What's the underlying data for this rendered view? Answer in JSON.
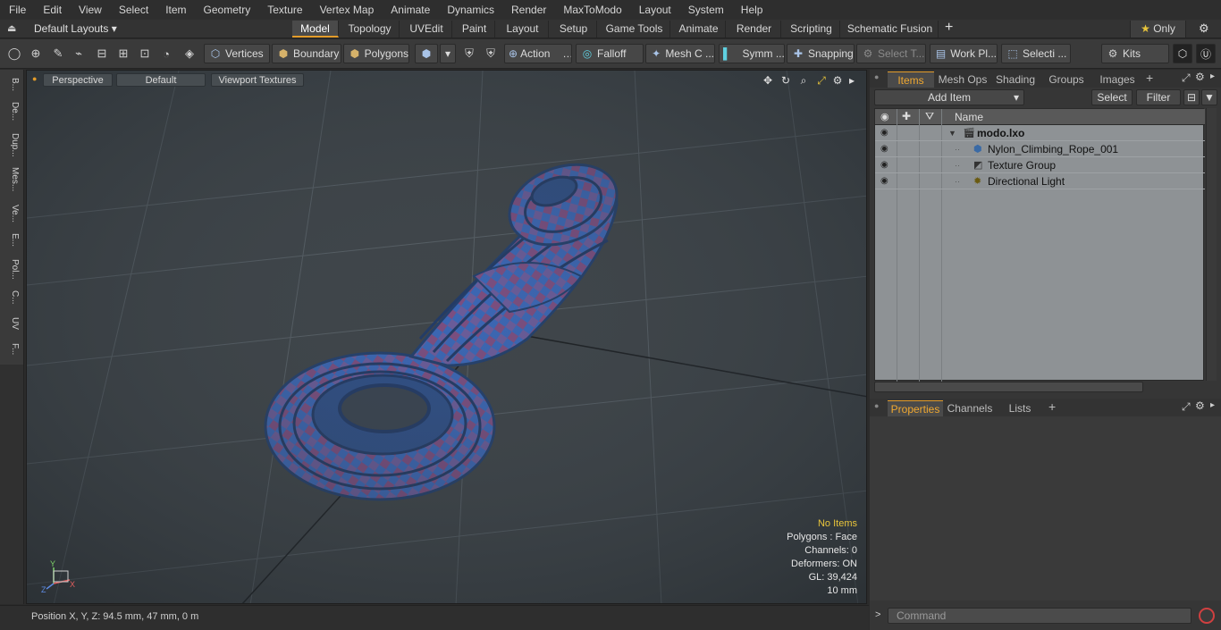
{
  "menu": [
    "File",
    "Edit",
    "View",
    "Select",
    "Item",
    "Geometry",
    "Texture",
    "Vertex Map",
    "Animate",
    "Dynamics",
    "Render",
    "MaxToModo",
    "Layout",
    "System",
    "Help"
  ],
  "modebar": {
    "layouts": "Default Layouts",
    "tabs": [
      "Model",
      "Topology",
      "UVEdit",
      "Paint",
      "Layout",
      "Setup",
      "Game Tools",
      "Animate",
      "Render",
      "Scripting",
      "Schematic Fusion"
    ],
    "active_tab": "Model",
    "only_label": "Only"
  },
  "toolbar": {
    "vertices": "Vertices",
    "boundary": "Boundary",
    "polygons": "Polygons",
    "action": "Action",
    "falloff": "Falloff",
    "mesh": "Mesh C ...",
    "symm": "Symm ...",
    "snapping": "Snapping",
    "select_t": "Select T...",
    "work_pl": "Work Pl...",
    "selecti": "Selecti ...",
    "kits": "Kits"
  },
  "left_tabs": [
    "B...",
    "De...",
    "Dup...",
    "Mes...",
    "Ve...",
    "E...",
    "Pol...",
    "C...",
    "UV",
    "F..."
  ],
  "viewport": {
    "perspective": "Perspective",
    "shading": "Default",
    "textures": "Viewport Textures",
    "info": {
      "no_items": "No Items",
      "polygons": "Polygons : Face",
      "channels": "Channels: 0",
      "deformers": "Deformers: ON",
      "gl": "GL: 39,424",
      "scale": "10 mm"
    },
    "axis": {
      "x": "X",
      "y": "Y",
      "z": "Z"
    }
  },
  "status": {
    "position": "Position X, Y, Z:   94.5 mm, 47 mm, 0 m"
  },
  "items_panel": {
    "tabs": [
      "Items",
      "Mesh Ops",
      "Shading",
      "Groups",
      "Images"
    ],
    "add_item": "Add Item",
    "select": "Select",
    "filter": "Filter",
    "col_name": "Name",
    "rows": [
      {
        "name": "modo.lxo"
      },
      {
        "name": "Nylon_Climbing_Rope_001"
      },
      {
        "name": "Texture Group"
      },
      {
        "name": "Directional Light"
      }
    ]
  },
  "props_panel": {
    "tabs": [
      "Properties",
      "Channels",
      "Lists"
    ],
    "command_placeholder": "Command"
  },
  "colors": {
    "accent": "#e39c2a",
    "rope_blue": "#3b67b5",
    "rope_red": "#8a4d78",
    "viewport_bg": "#3f4549"
  }
}
